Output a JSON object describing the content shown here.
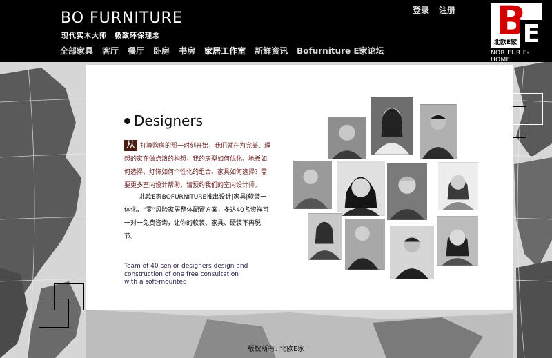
{
  "header": {
    "brand": "BO FURNITURE",
    "tagline": "现代实木大师　极致环保理念",
    "nav": [
      {
        "label": "全部家具",
        "active": false
      },
      {
        "label": "客厅",
        "active": false
      },
      {
        "label": "餐厅",
        "active": false
      },
      {
        "label": "卧房",
        "active": false
      },
      {
        "label": "书房",
        "active": false
      },
      {
        "label": "家居工作室",
        "active": true
      },
      {
        "label": "新鲜资讯",
        "active": false
      },
      {
        "label": "Bofurniture E家论坛",
        "active": false
      }
    ],
    "login": "登录",
    "register": "注册",
    "logo": {
      "letter_b": "B",
      "letter_e": "E",
      "cn": "北欧E家",
      "sub": "NOR EUR E-HOME"
    }
  },
  "content": {
    "title": "Designers",
    "dropcap": "从",
    "intro": "打算购房的那一时刻开始，我们就在为完美、理想的家在做点滴的构想，我的房型如何优化、地板如何选择、灯饰如何个性化的组合、家具如何选择？需要更多室内设计帮助，请预约我们的室内设计师。",
    "intro2": "北欧E家BOFURNITURE推出设计|家具|软装一体化，“零”风险家居整体配置方案，多达40名资祥可一对一免费咨询，让你的软装、家具、硬装不再脱节。",
    "caption": "Team of 40 senior designers design and construction of one free consultation with a soft-mounted"
  },
  "footer": {
    "copyright": "版权所有: 北欧E家"
  },
  "colors": {
    "header_bg": "#000000",
    "logo_red": "#d40000",
    "intro_text": "#6b1d1d",
    "dropcap_bg": "#4a1d12"
  }
}
